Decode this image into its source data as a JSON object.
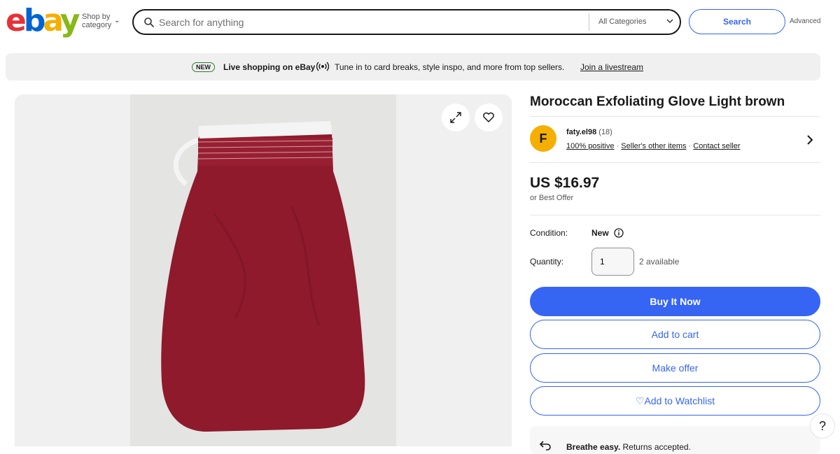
{
  "header": {
    "logo": {
      "e": "e",
      "b": "b",
      "a": "a",
      "y": "y"
    },
    "shop_by_line1": "Shop by",
    "shop_by_line2": "category",
    "search_placeholder": "Search for anything",
    "category_select": "All Categories",
    "search_button": "Search",
    "advanced_link": "Advanced"
  },
  "banner": {
    "badge": "NEW",
    "bold_text": "Live shopping on eBay",
    "text": "Tune in to card breaks, style inspo, and more from top sellers.",
    "link": "Join a livestream"
  },
  "gallery": {
    "expand_icon": "expand-icon",
    "watch_icon": "heart-icon"
  },
  "item": {
    "title": "Moroccan Exfoliating Glove Light brown",
    "seller": {
      "avatar_letter": "F",
      "name": "faty.el98",
      "feedback_count": "(18)",
      "positive": "100% positive",
      "other_items": "Seller's other items",
      "contact": "Contact seller"
    },
    "price": "US $16.97",
    "best_offer": "or Best Offer",
    "condition_label": "Condition:",
    "condition_value": "New",
    "quantity_label": "Quantity:",
    "quantity_value": "1",
    "quantity_available": "2 available",
    "buy_now": "Buy It Now",
    "add_to_cart": "Add to cart",
    "make_offer": "Make offer",
    "watchlist_icon": "♡",
    "add_to_watchlist": "Add to Watchlist",
    "returns_bold": "Breathe easy.",
    "returns_text": "Returns accepted."
  },
  "help": "?",
  "colors": {
    "primary_blue": "#3665f3",
    "logo_red": "#e53238",
    "logo_blue": "#0064d2",
    "logo_yellow": "#f5af02",
    "logo_green": "#86b817",
    "product_red": "#8e1a2c"
  }
}
